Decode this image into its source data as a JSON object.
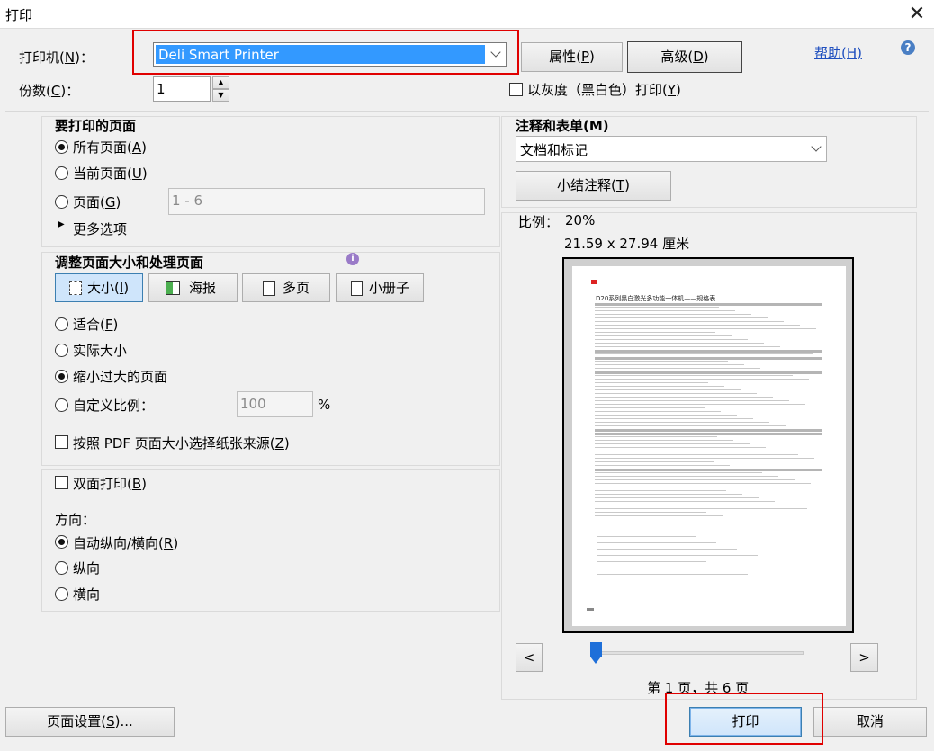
{
  "window": {
    "title": "打印",
    "close_glyph": "✕"
  },
  "printer": {
    "label": "打印机(",
    "mnemonic": "N",
    "label_end": ")：",
    "value": "Deli Smart Printer",
    "properties": "属性(",
    "properties_key": "P",
    "advanced": "高级(",
    "advanced_key": "D",
    "help": "帮助(H)",
    "help_glyph": "?"
  },
  "copies": {
    "label": "份数(",
    "mnemonic": "C",
    "label_end": ")：",
    "value": "1",
    "grayscale": "以灰度（黑白色）打印(",
    "grayscale_key": "Y"
  },
  "pages": {
    "heading": "要打印的页面",
    "all": "所有页面(",
    "all_key": "A",
    "current": "当前页面(",
    "current_key": "U",
    "range": "页面(",
    "range_key": "G",
    "range_value": "1 - 6",
    "more": "更多选项"
  },
  "sizing": {
    "heading": "调整页面大小和处理页面",
    "tabs": [
      "大小(",
      "海报",
      "多页",
      "小册子"
    ],
    "size_key": "I",
    "fit": "适合(",
    "fit_key": "F",
    "actual": "实际大小",
    "shrink": "缩小过大的页面",
    "custom": "自定义比例：",
    "custom_value": "100",
    "percent": "%",
    "paper_source": "按照 PDF 页面大小选择纸张来源(",
    "paper_source_key": "Z"
  },
  "duplex": {
    "label": "双面打印(",
    "key": "B",
    "orientation_heading": "方向：",
    "auto": "自动纵向/横向(",
    "auto_key": "R",
    "portrait": "纵向",
    "landscape": "横向"
  },
  "comments": {
    "heading": "注释和表单(M)",
    "value": "文档和标记",
    "summarize": "小结注释(",
    "summarize_key": "T"
  },
  "preview": {
    "scale_label": "比例：",
    "scale_value": "20%",
    "dimensions": "21.59 x 27.94 厘米",
    "doc_title": "D20系列黑白激光多功能一体机——规格表",
    "page_status": "第 1 页，共 6 页",
    "prev": "<",
    "next": ">"
  },
  "footer": {
    "page_setup": "页面设置(",
    "page_setup_key": "S",
    "page_setup_end": ")...",
    "print": "打印",
    "cancel": "取消"
  }
}
